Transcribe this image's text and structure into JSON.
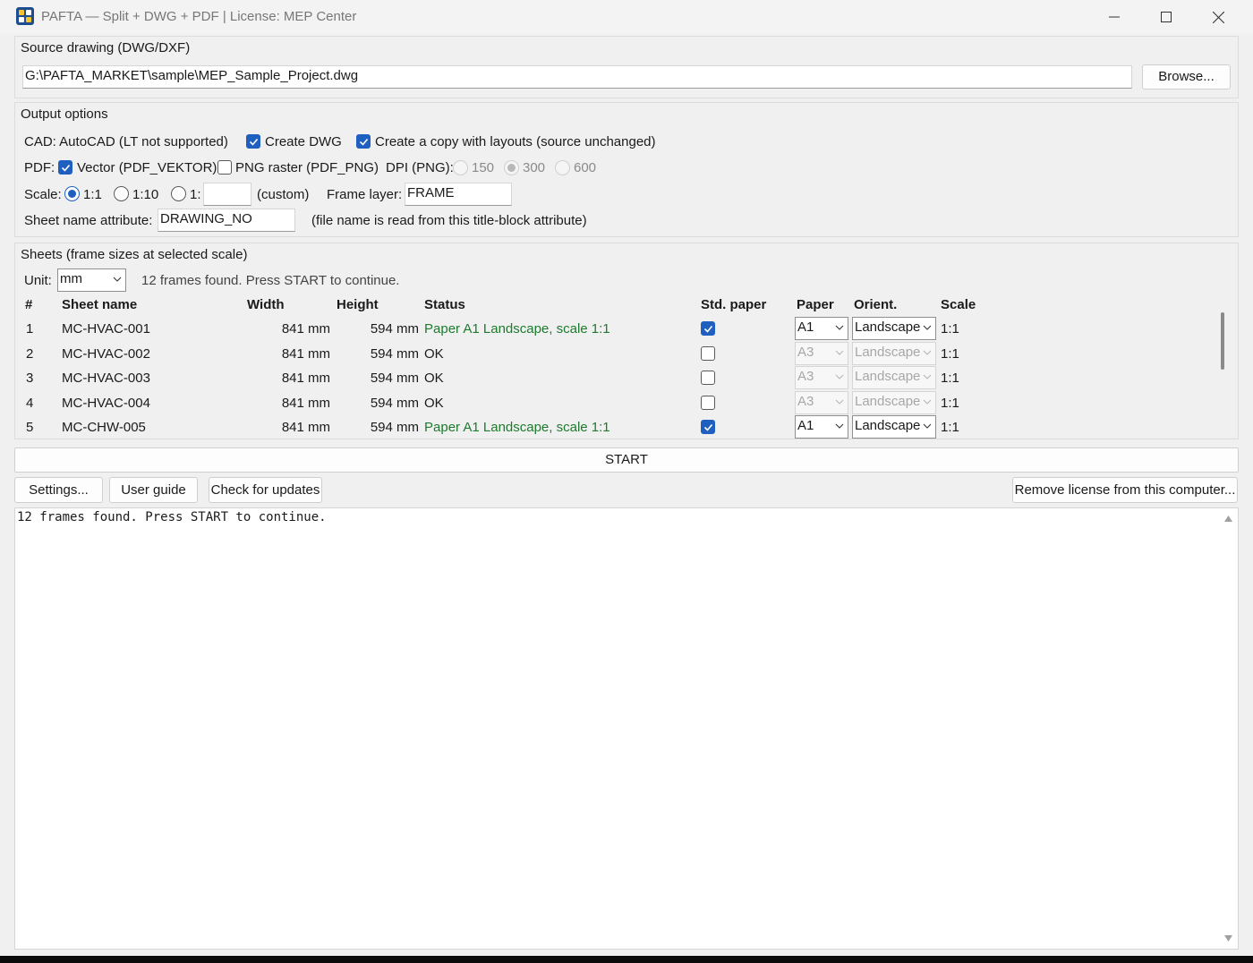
{
  "window": {
    "title": "PAFTA — Split + DWG + PDF  |  License: MEP Center"
  },
  "source": {
    "group_title": "Source drawing (DWG/DXF)",
    "path": "G:\\PAFTA_MARKET\\sample\\MEP_Sample_Project.dwg",
    "browse_label": "Browse..."
  },
  "output": {
    "group_title": "Output options",
    "cad_label": "CAD: AutoCAD (LT not supported)",
    "create_dwg_label": "Create DWG",
    "create_dwg_checked": true,
    "copy_layouts_label": "Create a copy with layouts (source unchanged)",
    "copy_layouts_checked": true,
    "pdf_label": "PDF:",
    "vector_label": "Vector (PDF_VEKTOR)",
    "vector_checked": true,
    "png_label": "PNG raster (PDF_PNG)",
    "png_checked": false,
    "dpi_label": "DPI (PNG):",
    "dpi_options": [
      "150",
      "300",
      "600"
    ],
    "dpi_selected": "300",
    "scale_label": "Scale:",
    "scale_options": [
      "1:1",
      "1:10",
      "1:"
    ],
    "scale_selected": "1:1",
    "custom_value": "",
    "custom_label": "(custom)",
    "frame_layer_label": "Frame layer:",
    "frame_layer_value": "FRAME",
    "sheet_attr_label": "Sheet name attribute:",
    "sheet_attr_value": "DRAWING_NO",
    "sheet_attr_hint": "(file name is read from this title-block attribute)"
  },
  "sheets": {
    "group_title": "Sheets (frame sizes at selected scale)",
    "unit_label": "Unit:",
    "unit_value": "mm",
    "found_text": "12 frames found. Press START to continue.",
    "columns": {
      "index": "#",
      "name": "Sheet name",
      "width": "Width",
      "height": "Height",
      "status": "Status",
      "std_paper": "Std. paper",
      "paper": "Paper",
      "orient": "Orient.",
      "scale": "Scale"
    },
    "rows": [
      {
        "index": "1",
        "name": "MC-HVAC-001",
        "width": "841 mm",
        "height": "594 mm",
        "status": "Paper A1 Landscape, scale 1:1",
        "status_ok": false,
        "std": true,
        "paper": "A1",
        "orient": "Landscape",
        "scale": "1:1"
      },
      {
        "index": "2",
        "name": "MC-HVAC-002",
        "width": "841 mm",
        "height": "594 mm",
        "status": "OK",
        "status_ok": true,
        "std": false,
        "paper": "A3",
        "orient": "Landscape",
        "scale": "1:1"
      },
      {
        "index": "3",
        "name": "MC-HVAC-003",
        "width": "841 mm",
        "height": "594 mm",
        "status": "OK",
        "status_ok": true,
        "std": false,
        "paper": "A3",
        "orient": "Landscape",
        "scale": "1:1"
      },
      {
        "index": "4",
        "name": "MC-HVAC-004",
        "width": "841 mm",
        "height": "594 mm",
        "status": "OK",
        "status_ok": true,
        "std": false,
        "paper": "A3",
        "orient": "Landscape",
        "scale": "1:1"
      },
      {
        "index": "5",
        "name": "MC-CHW-005",
        "width": "841 mm",
        "height": "594 mm",
        "status": "Paper A1 Landscape, scale 1:1",
        "status_ok": false,
        "std": true,
        "paper": "A1",
        "orient": "Landscape",
        "scale": "1:1"
      }
    ]
  },
  "actions": {
    "start_label": "START",
    "settings_label": "Settings...",
    "guide_label": "User guide",
    "updates_label": "Check for updates",
    "remove_license_label": "Remove license from this computer..."
  },
  "log": {
    "text": "12 frames found. Press START to continue."
  },
  "colors": {
    "accent": "#1f5fbf",
    "status_green": "#1d7a2e"
  },
  "icons": {
    "app": "app-grid-icon",
    "minimize": "minimize-icon",
    "maximize": "maximize-icon",
    "close": "close-icon",
    "dropdown": "chevron-down-icon",
    "check": "checkmark-icon"
  }
}
